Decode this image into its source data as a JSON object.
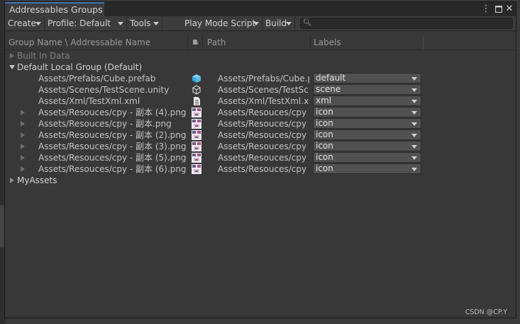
{
  "window": {
    "tab_title": "Addressables Groups",
    "menu_icon": "kebab-menu-icon",
    "maximize_icon": "maximize-icon",
    "close_icon": "close-icon"
  },
  "toolbar": {
    "create_label": "Create",
    "profile_label": "Profile: Default",
    "tools_label": "Tools",
    "play_mode_label": "Play Mode Script",
    "build_label": "Build",
    "search_value": "",
    "search_icon": "search-icon"
  },
  "columns": {
    "name": "Group Name \\ Addressable Name",
    "icon": "asset-type-icon",
    "path": "Path",
    "labels": "Labels"
  },
  "groups": [
    {
      "name": "Built In Data",
      "expanded": false,
      "dimmed": true
    },
    {
      "name": "Default Local Group (Default)",
      "expanded": true,
      "dimmed": false
    },
    {
      "name": "MyAssets",
      "expanded": false,
      "dimmed": false
    }
  ],
  "entries": [
    {
      "name": "Assets/Prefabs/Cube.prefab",
      "icon": "prefab-cube-icon",
      "path": "Assets/Prefabs/Cube.p",
      "label": "default",
      "expandable": false
    },
    {
      "name": "Assets/Scenes/TestScene.unity",
      "icon": "unity-scene-icon",
      "path": "Assets/Scenes/TestSc",
      "label": "scene",
      "expandable": false
    },
    {
      "name": "Assets/Xml/TestXml.xml",
      "icon": "text-file-icon",
      "path": "Assets/Xml/TestXml.xm",
      "label": "xml",
      "expandable": false
    },
    {
      "name": "Assets/Resouces/cpy - 副本 (4).png",
      "icon": "image-thumbnail-icon",
      "path": "Assets/Resouces/cpy -",
      "label": "icon",
      "expandable": true
    },
    {
      "name": "Assets/Resouces/cpy - 副本.png",
      "icon": "image-thumbnail-icon",
      "path": "Assets/Resouces/cpy -",
      "label": "icon",
      "expandable": true
    },
    {
      "name": "Assets/Resouces/cpy - 副本 (2).png",
      "icon": "image-thumbnail-icon",
      "path": "Assets/Resouces/cpy -",
      "label": "icon",
      "expandable": true
    },
    {
      "name": "Assets/Resouces/cpy - 副本 (3).png",
      "icon": "image-thumbnail-icon",
      "path": "Assets/Resouces/cpy -",
      "label": "icon",
      "expandable": true
    },
    {
      "name": "Assets/Resouces/cpy - 副本 (5).png",
      "icon": "image-thumbnail-icon",
      "path": "Assets/Resouces/cpy -",
      "label": "icon",
      "expandable": true
    },
    {
      "name": "Assets/Resouces/cpy - 副本 (6).png",
      "icon": "image-thumbnail-icon",
      "path": "Assets/Resouces/cpy -",
      "label": "icon",
      "expandable": true
    }
  ],
  "watermark": "CSDN @CP.Y",
  "colors": {
    "accent": "#3a79bb",
    "window_bg": "#383838",
    "toolbar_bg": "#3c3c3c",
    "dropdown_bg": "#515151"
  }
}
